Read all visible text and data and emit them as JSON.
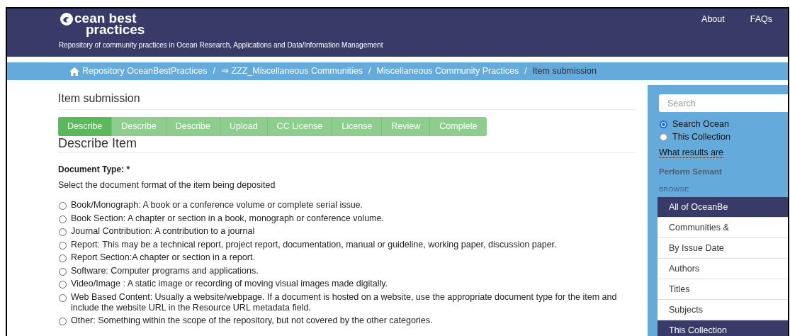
{
  "header": {
    "logo_text_1": "cean best",
    "logo_text_2": "practices",
    "tagline": "Repository of community practices in Ocean Research, Applications and Data/Information Management",
    "nav": [
      "About",
      "FAQs"
    ]
  },
  "breadcrumb_separator": "/",
  "breadcrumb": [
    {
      "label": "Repository OceanBestPractices",
      "kind": "home"
    },
    {
      "label": "⇒ ZZZ_Miscellaneous Communities",
      "kind": "link"
    },
    {
      "label": "Miscellaneous Community Practices",
      "kind": "link"
    },
    {
      "label": "Item submission",
      "kind": "current"
    }
  ],
  "page_title": "Item submission",
  "steps": [
    {
      "label": "Describe",
      "selected": true
    },
    {
      "label": "Describe",
      "selected": false
    },
    {
      "label": "Describe",
      "selected": false
    },
    {
      "label": "Upload",
      "selected": false
    },
    {
      "label": "CC License",
      "selected": false
    },
    {
      "label": "License",
      "selected": false
    },
    {
      "label": "Review",
      "selected": false
    },
    {
      "label": "Complete",
      "selected": false
    }
  ],
  "section_title": "Describe Item",
  "field": {
    "label": "Document Type: *",
    "help": "Select the document format of the item being deposited",
    "options": [
      {
        "label": "Book/Monograph: A book or a conference volume or complete serial issue.",
        "selected": false
      },
      {
        "label": "Book Section: A chapter or section in a book, monograph or conference volume.",
        "selected": false
      },
      {
        "label": "Journal Contribution: A contribution to a journal",
        "selected": false
      },
      {
        "label": "Report: This may be a technical report, project report, documentation, manual or guideline, working paper, discussion paper.",
        "selected": false
      },
      {
        "label": "Report Section:A chapter or section in a report.",
        "selected": false
      },
      {
        "label": "Software: Computer programs and applications.",
        "selected": false
      },
      {
        "label": "Video/Image : A static image or recording of moving visual images made digitally.",
        "selected": false
      },
      {
        "label": "Web Based Content: Usually a website/webpage. If a document is hosted on a website, use the appropriate document type for the item and include the website URL in the Resource URL metadata field.",
        "selected": false
      },
      {
        "label": "Other: Something within the scope of the repository, but not covered by the other categories.",
        "selected": false
      }
    ]
  },
  "sidebar": {
    "search": {
      "placeholder": "Search"
    },
    "scope": [
      {
        "label": "Search Ocean",
        "selected": true
      },
      {
        "label": "This Collection",
        "selected": false
      }
    ],
    "help_link": "What results are",
    "semantic": "Perform Semant",
    "browse_heading": "BROWSE",
    "browse": [
      {
        "label": "All of OceanBe",
        "kind": "header"
      },
      {
        "label": "Communities &",
        "kind": "item"
      },
      {
        "label": "By Issue Date",
        "kind": "item"
      },
      {
        "label": "Authors",
        "kind": "item"
      },
      {
        "label": "Titles",
        "kind": "item"
      },
      {
        "label": "Subjects",
        "kind": "item"
      },
      {
        "label": "This Collection",
        "kind": "header"
      }
    ]
  }
}
